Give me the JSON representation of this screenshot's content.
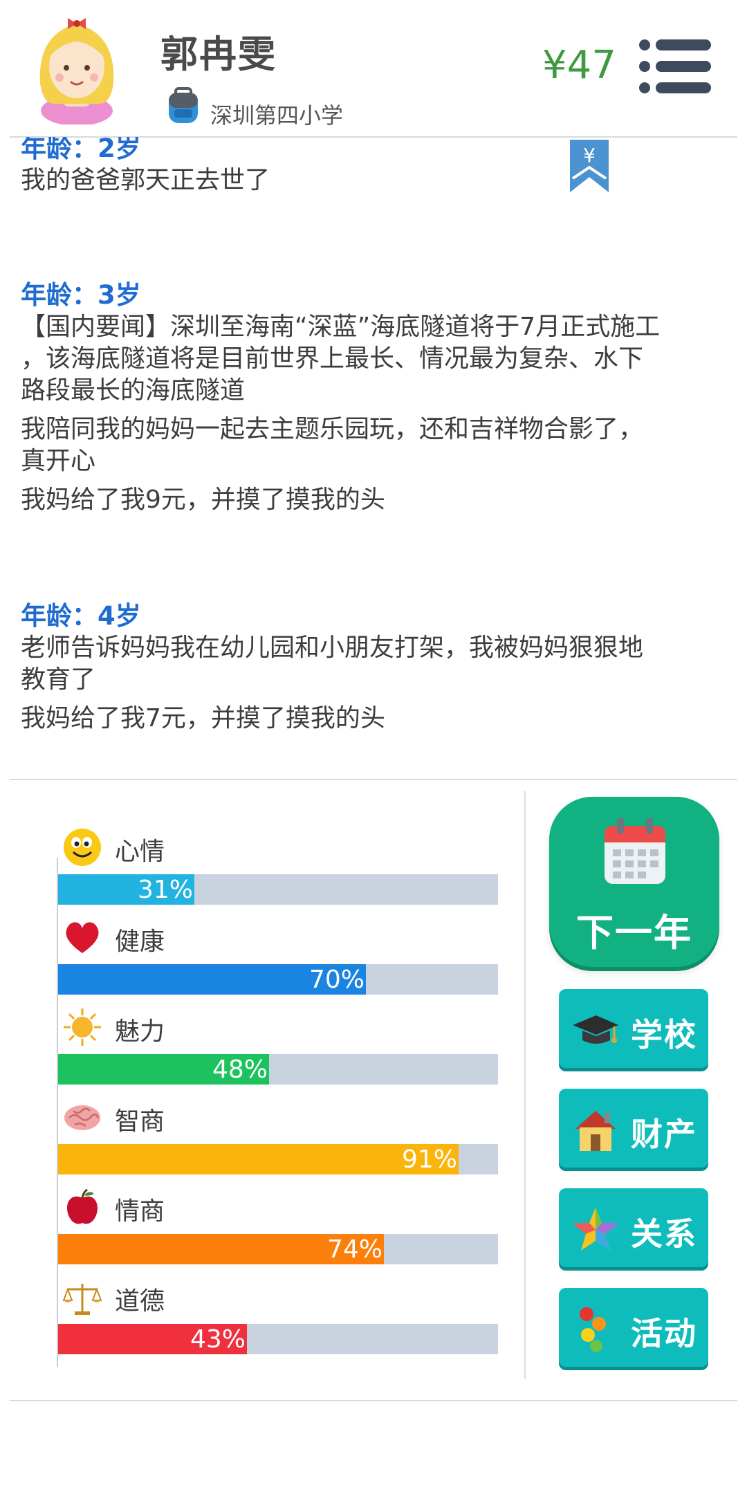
{
  "header": {
    "name": "郭冉雯",
    "school": "深圳第四小学",
    "money": "¥47"
  },
  "bookmark_symbol": "¥",
  "log": [
    {
      "age": "年龄：2岁",
      "lines": [
        "我的爸爸郭天正去世了"
      ]
    },
    {
      "age": "年龄：3岁",
      "lines": [
        "【国内要闻】深圳至海南“深蓝”海底隧道将于7月正式施工",
        "，该海底隧道将是目前世界上最长、情况最为复杂、水下",
        "路段最长的海底隧道",
        "我陪同我的妈妈一起去主题乐园玩，还和吉祥物合影了，",
        "真开心",
        "我妈给了我9元，并摸了摸我的头"
      ]
    },
    {
      "age": "年龄：4岁",
      "lines": [
        "老师告诉妈妈我在幼儿园和小朋友打架，我被妈妈狠狠地",
        "教育了",
        "我妈给了我7元，并摸了摸我的头"
      ]
    }
  ],
  "stats": [
    {
      "label": "心情",
      "value": 31,
      "pct": "31%",
      "color": "#22b3e0",
      "icon": "smiley-icon"
    },
    {
      "label": "健康",
      "value": 70,
      "pct": "70%",
      "color": "#1a85e0",
      "icon": "heart-icon"
    },
    {
      "label": "魅力",
      "value": 48,
      "pct": "48%",
      "color": "#1cc25e",
      "icon": "sun-icon"
    },
    {
      "label": "智商",
      "value": 91,
      "pct": "91%",
      "color": "#fbb40c",
      "icon": "brain-icon"
    },
    {
      "label": "情商",
      "value": 74,
      "pct": "74%",
      "color": "#fb7f0a",
      "icon": "apple-icon"
    },
    {
      "label": "道德",
      "value": 43,
      "pct": "43%",
      "color": "#f1303e",
      "icon": "scale-icon"
    }
  ],
  "buttons": {
    "next_year": "下一年",
    "school": "学校",
    "assets": "财产",
    "relations": "关系",
    "activities": "活动"
  }
}
